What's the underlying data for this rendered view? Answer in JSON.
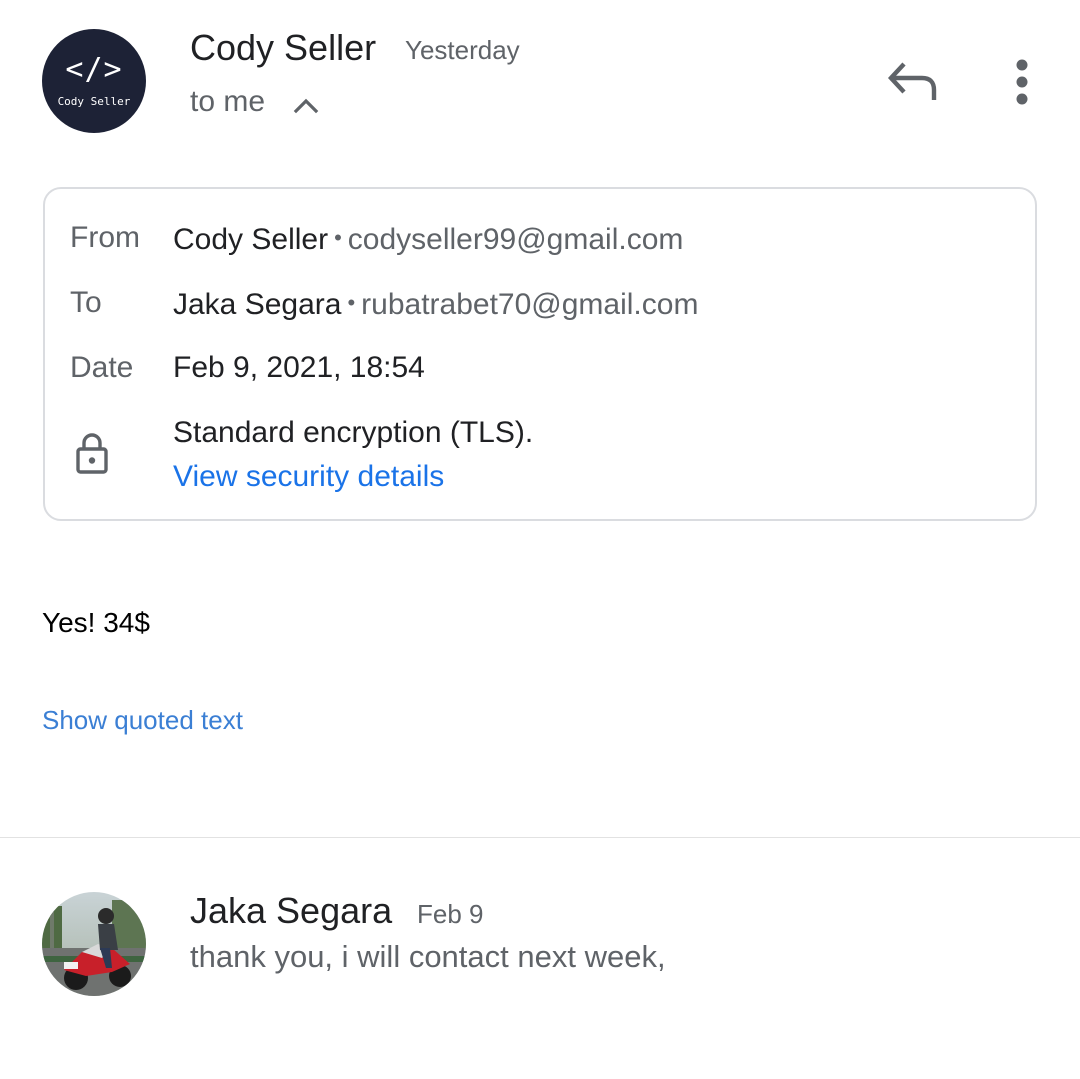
{
  "message": {
    "sender": {
      "name": "Cody Seller",
      "avatar_logo_glyph": "</>",
      "avatar_logo_text": "Cody Seller",
      "avatar_color": "#1d2236"
    },
    "date": "Yesterday",
    "recipient_summary": "to me",
    "icons": {
      "expand": "chevron-up-icon",
      "reply": "reply-icon",
      "more": "more-vertical-icon"
    },
    "details": {
      "from_label": "From",
      "from_name": "Cody Seller",
      "from_email": "codyseller99@gmail.com",
      "to_label": "To",
      "to_name": "Jaka Segara",
      "to_email": "rubatrabet70@gmail.com",
      "date_label": "Date",
      "date_value": "Feb 9, 2021, 18:54",
      "separator": "•",
      "security_icon": "lock-icon",
      "security_text": "Standard encryption (TLS).",
      "security_link": "View security details"
    },
    "body": "Yes! 34$",
    "show_quoted": "Show quoted text"
  },
  "previous_message": {
    "sender_name": "Jaka Segara",
    "date": "Feb 9",
    "snippet": "thank you, i will contact next week,"
  },
  "colors": {
    "link": "#1a73e8",
    "secondary_text": "#5f6368",
    "border": "#dadce0"
  }
}
